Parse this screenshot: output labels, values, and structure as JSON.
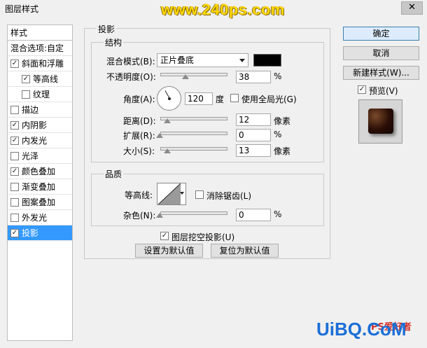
{
  "window": {
    "title": "图层样式",
    "watermark": "www.240ps.com",
    "close_glyph": "✕"
  },
  "sidebar": {
    "header": "样式",
    "items": [
      {
        "label": "混合选项:自定",
        "checked": null,
        "sub": false,
        "selected": false
      },
      {
        "label": "斜面和浮雕",
        "checked": true,
        "sub": false,
        "selected": false
      },
      {
        "label": "等高线",
        "checked": true,
        "sub": true,
        "selected": false
      },
      {
        "label": "纹理",
        "checked": false,
        "sub": true,
        "selected": false
      },
      {
        "label": "描边",
        "checked": false,
        "sub": false,
        "selected": false
      },
      {
        "label": "内阴影",
        "checked": true,
        "sub": false,
        "selected": false
      },
      {
        "label": "内发光",
        "checked": true,
        "sub": false,
        "selected": false
      },
      {
        "label": "光泽",
        "checked": false,
        "sub": false,
        "selected": false
      },
      {
        "label": "颜色叠加",
        "checked": true,
        "sub": false,
        "selected": false
      },
      {
        "label": "渐变叠加",
        "checked": false,
        "sub": false,
        "selected": false
      },
      {
        "label": "图案叠加",
        "checked": false,
        "sub": false,
        "selected": false
      },
      {
        "label": "外发光",
        "checked": false,
        "sub": false,
        "selected": false
      },
      {
        "label": "投影",
        "checked": true,
        "sub": false,
        "selected": true
      }
    ]
  },
  "drop_shadow": {
    "section_title": "投影",
    "structure": {
      "title": "结构",
      "blend_mode_label": "混合模式(B):",
      "blend_mode_value": "正片叠底",
      "shadow_color": "#000000",
      "opacity_label": "不透明度(O):",
      "opacity_value": "38",
      "angle_label": "角度(A):",
      "angle_value": "120",
      "angle_unit": "度",
      "global_light_label": "使用全局光(G)",
      "global_light_checked": false,
      "distance_label": "距离(D):",
      "distance_value": "12",
      "size_unit": "像素",
      "spread_label": "扩展(R):",
      "spread_value": "0",
      "size_label": "大小(S):",
      "size_value": "13",
      "percent_unit": "%"
    },
    "quality": {
      "title": "品质",
      "contour_label": "等高线:",
      "anti_alias_label": "消除锯齿(L)",
      "anti_alias_checked": false,
      "noise_label": "杂色(N):",
      "noise_value": "0"
    },
    "knockout_label": "图层挖空投影(U)",
    "knockout_checked": true,
    "make_default_label": "设置为默认值",
    "reset_default_label": "复位为默认值"
  },
  "actions": {
    "ok_label": "确定",
    "cancel_label": "取消",
    "new_style_label": "新建样式(W)...",
    "preview_label": "预览(V)",
    "preview_checked": true
  },
  "footer_watermark": {
    "brand": "UiBQ.CoM",
    "small": "PS爱好者"
  }
}
